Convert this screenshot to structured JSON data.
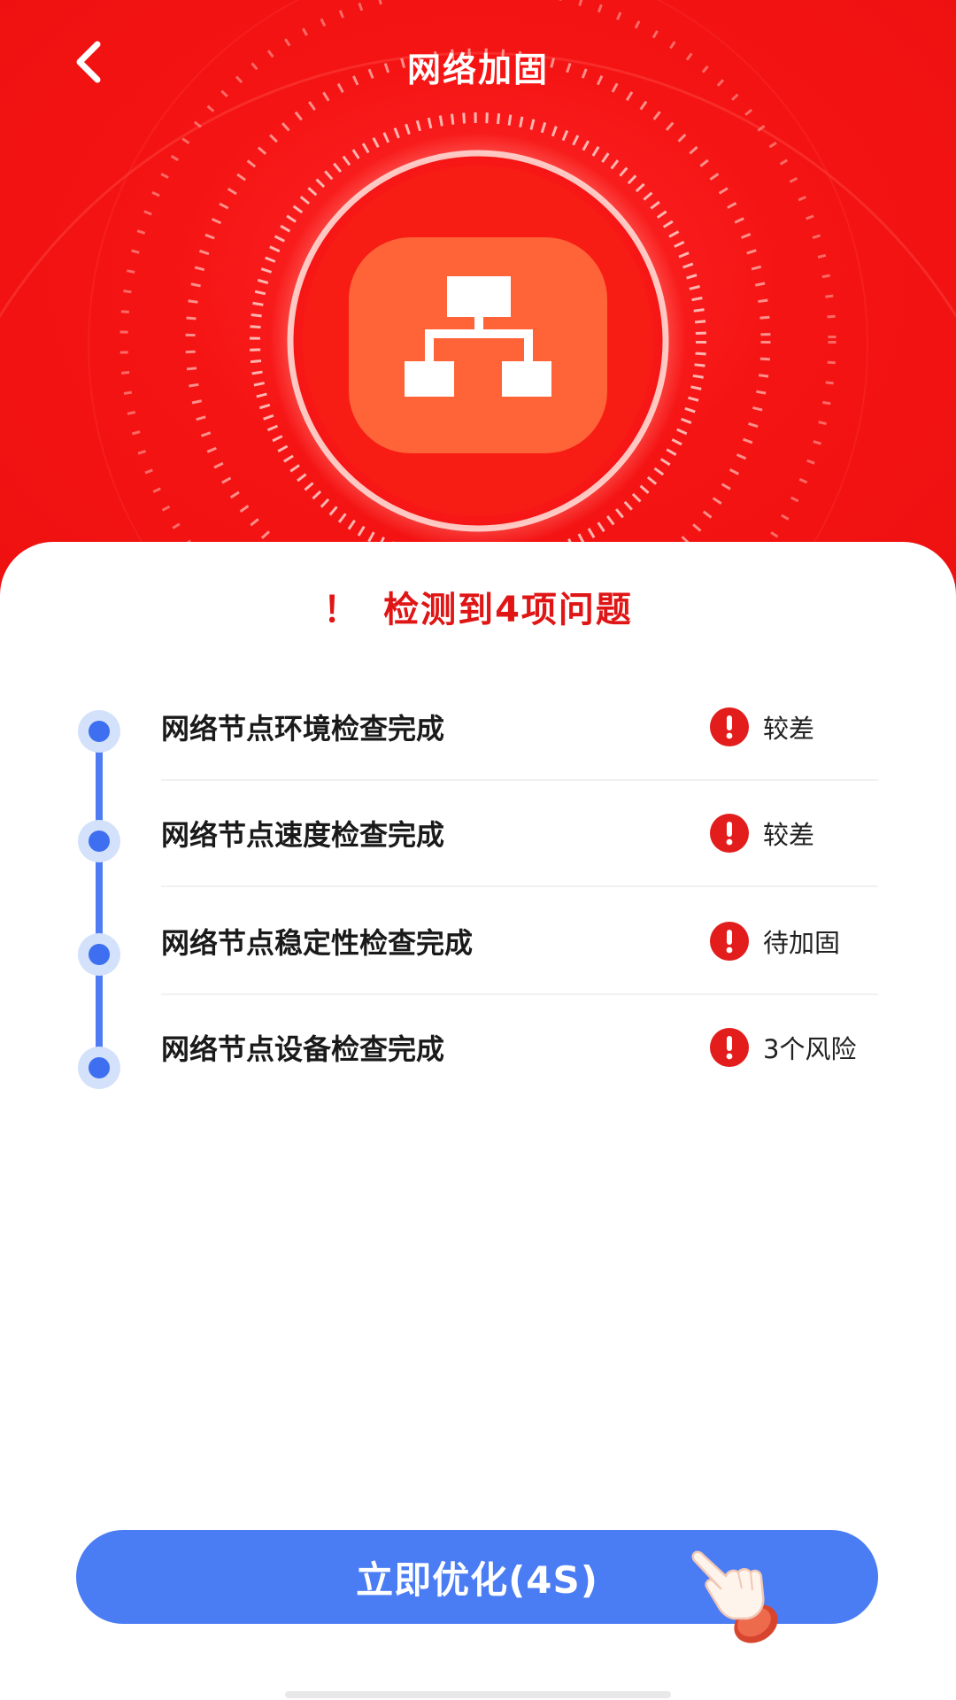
{
  "header": {
    "title": "网络加固",
    "back_icon": "chevron-left-icon",
    "center_icon": "network-topology-icon",
    "background_color": "#f51414"
  },
  "summary": {
    "alert_mark": "！",
    "text": "检测到4项问题",
    "color": "#e01515"
  },
  "checks": [
    {
      "label": "网络节点环境检查完成",
      "status": "较差",
      "status_icon": "alert-circle-icon"
    },
    {
      "label": "网络节点速度检查完成",
      "status": "较差",
      "status_icon": "alert-circle-icon"
    },
    {
      "label": "网络节点稳定性检查完成",
      "status": "待加固",
      "status_icon": "alert-circle-icon"
    },
    {
      "label": "网络节点设备检查完成",
      "status": "3个风险",
      "status_icon": "alert-circle-icon"
    }
  ],
  "timeline_color": "#3d6ff0",
  "action_button": {
    "label": "立即优化(4S)",
    "color": "#4a7cf3",
    "pointer_icon": "pointing-hand-icon"
  }
}
